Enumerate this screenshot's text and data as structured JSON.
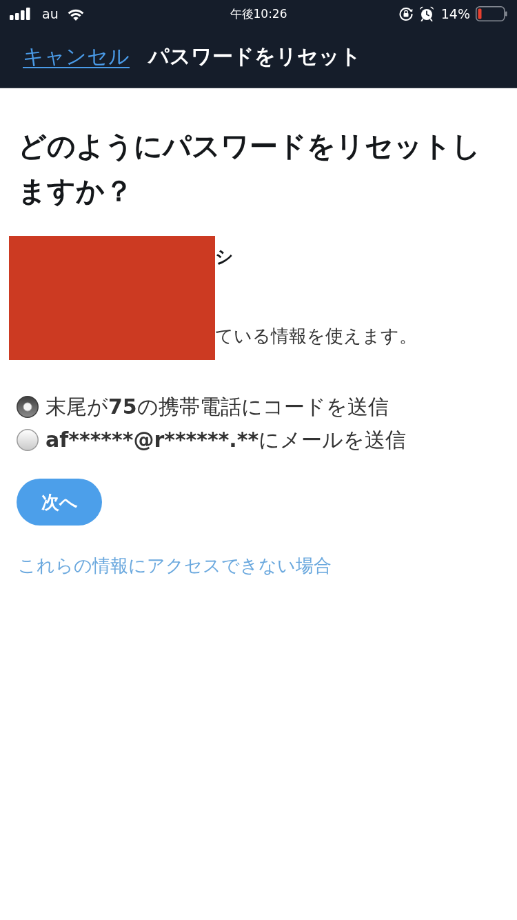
{
  "status_bar": {
    "carrier": "au",
    "time": "午後10:26",
    "battery": "14%"
  },
  "nav": {
    "cancel": "キャンセル",
    "title": "パスワードをリセット"
  },
  "heading": "どのようにパスワードをリセットしますか？",
  "redacted_section": {
    "redacted": true,
    "title_fragment": "シ",
    "description_fragment": "ている情報を使えます。"
  },
  "options": [
    {
      "selected": true,
      "parts": [
        {
          "text": "末尾が",
          "bold": false
        },
        {
          "text": "75",
          "bold": true
        },
        {
          "text": "の携帯電話にコードを送信",
          "bold": false
        }
      ]
    },
    {
      "selected": false,
      "parts": [
        {
          "text": "af******@r******.**",
          "bold": true
        },
        {
          "text": "にメールを送信",
          "bold": false
        }
      ]
    }
  ],
  "next_button": "次へ",
  "help_link": "これらの情報にアクセスできない場合"
}
